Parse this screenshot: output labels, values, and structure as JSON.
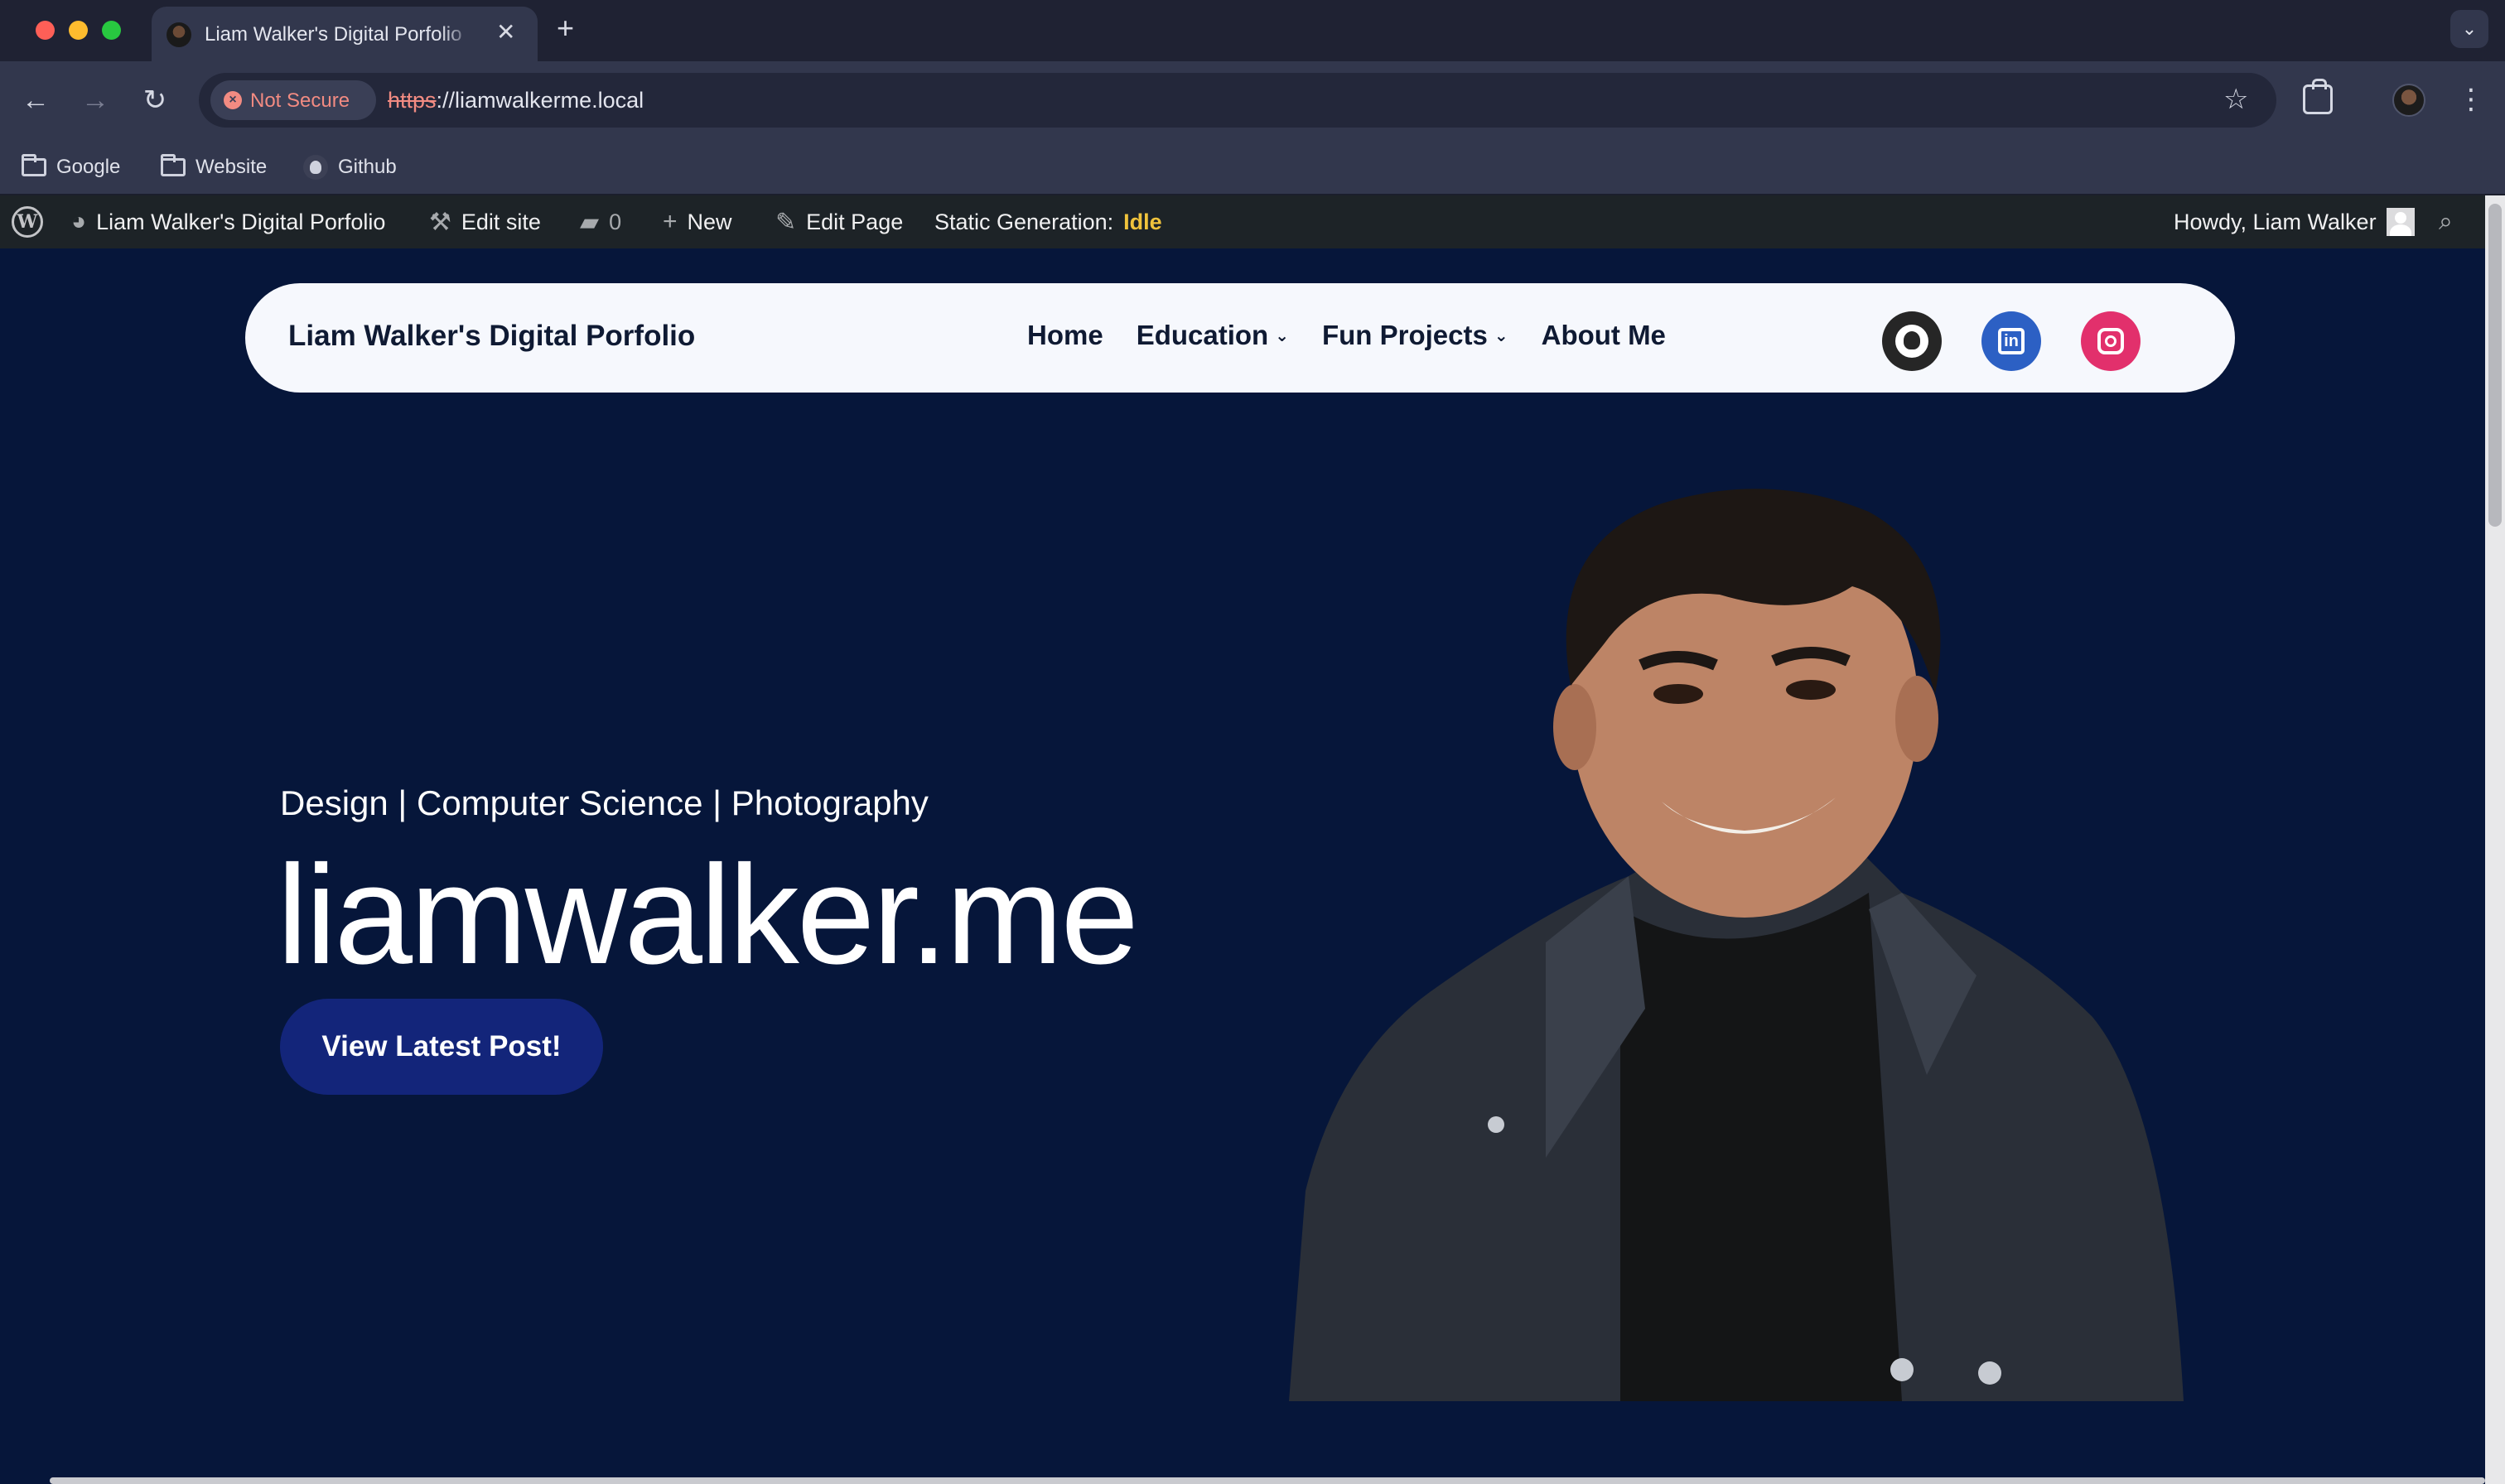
{
  "browser": {
    "tab_title": "Liam Walker's Digital Porfolio",
    "tab_close": "✕",
    "new_tab": "+",
    "tab_search": "⌄",
    "back": "←",
    "forward": "→",
    "reload": "↻",
    "security_label": "Not Secure",
    "security_icon": "×",
    "url_scheme": "https",
    "url_rest": "://liamwalkerme.local",
    "star": "☆",
    "menu": "⋮",
    "bookmarks": [
      {
        "label": "Google",
        "icon": "folder-icon"
      },
      {
        "label": "Website",
        "icon": "folder-icon"
      },
      {
        "label": "Github",
        "icon": "github-icon"
      }
    ]
  },
  "adminbar": {
    "wp_logo": "W",
    "site_name": "Liam Walker's Digital Porfolio",
    "edit_site": "Edit site",
    "comments_count": "0",
    "new_label": "New",
    "edit_page": "Edit Page",
    "static_generation_label": "Static Generation:",
    "static_generation_status": "Idle",
    "howdy": "Howdy, Liam Walker"
  },
  "site": {
    "title": "Liam Walker's Digital Porfolio",
    "nav": [
      {
        "label": "Home",
        "has_dropdown": false
      },
      {
        "label": "Education",
        "has_dropdown": true
      },
      {
        "label": "Fun Projects",
        "has_dropdown": true
      },
      {
        "label": "About Me",
        "has_dropdown": false
      }
    ],
    "chevron": "⌄",
    "social": [
      {
        "name": "github",
        "color": "#262626"
      },
      {
        "name": "linkedin",
        "color": "#2c60c4",
        "glyph": "in"
      },
      {
        "name": "instagram",
        "color": "#e2306c"
      }
    ]
  },
  "hero": {
    "tagline": "Design | Computer Science | Photography",
    "title": "liamwalker.me",
    "cta": "View Latest Post!"
  },
  "colors": {
    "page_background": "#06163a",
    "header_background": "#f6f8fd",
    "cta_background": "#13257a",
    "admin_bar": "#1d2327",
    "idle_status": "#f0c33c"
  }
}
